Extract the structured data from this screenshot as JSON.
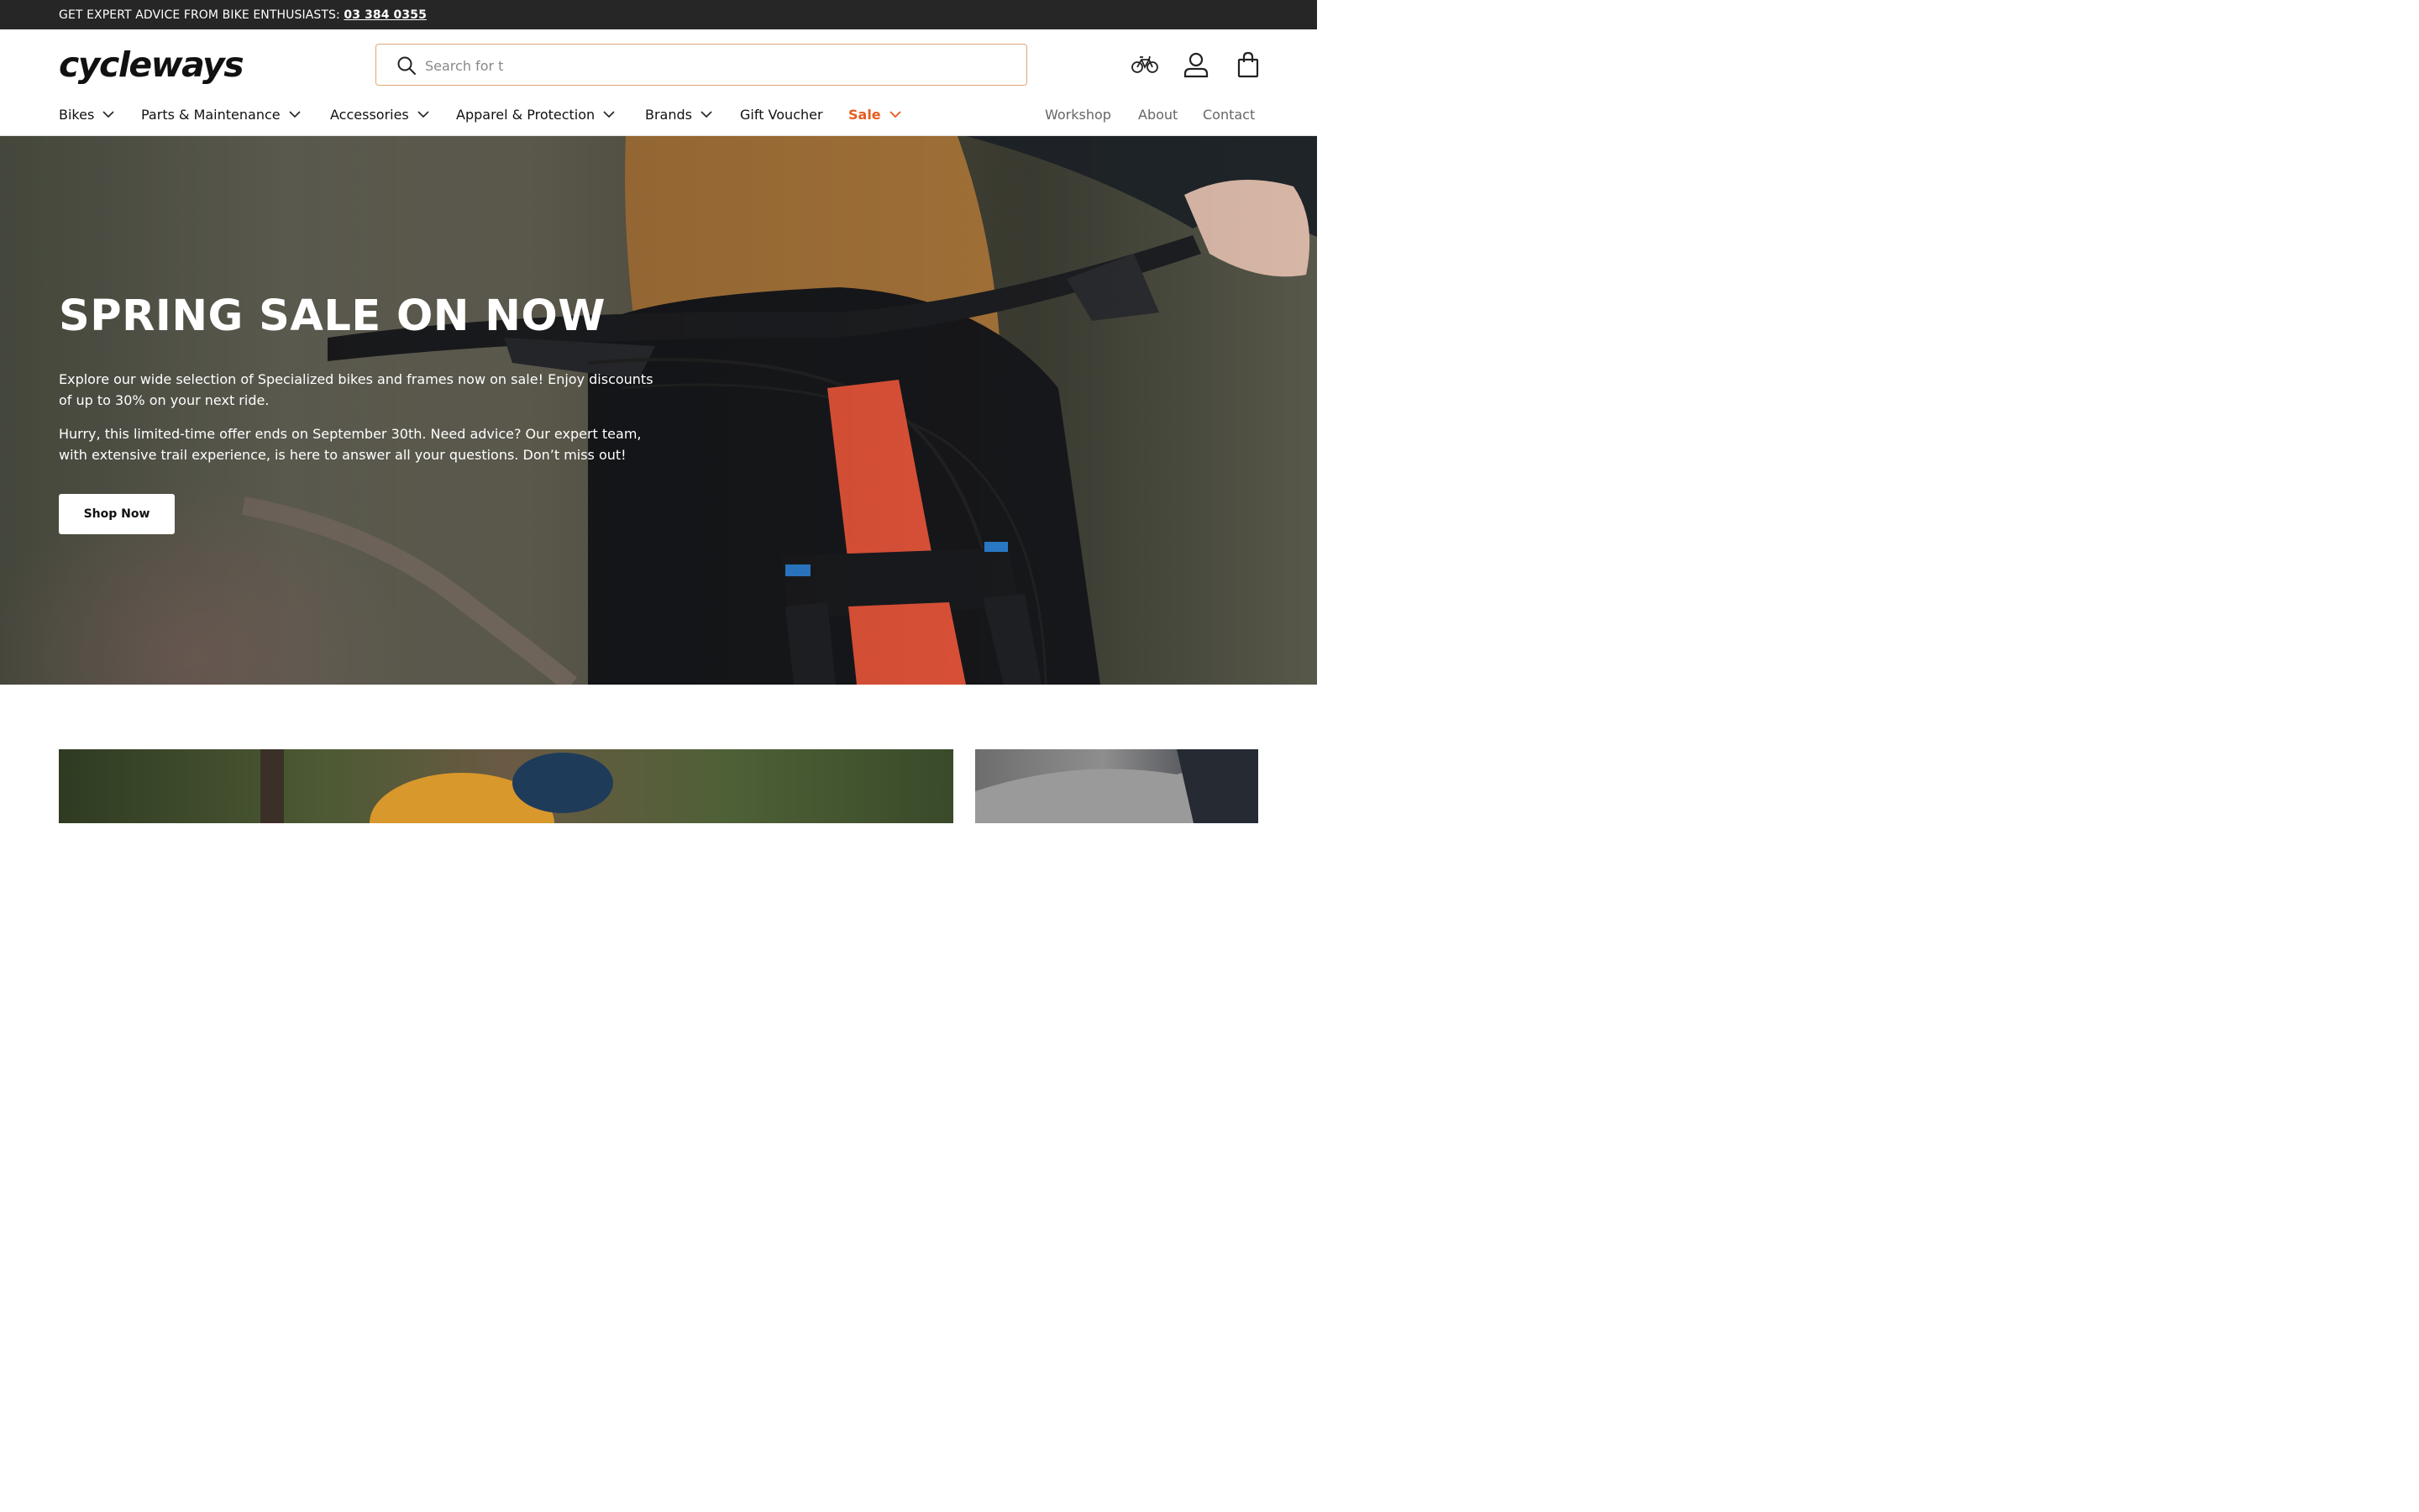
{
  "announcement": {
    "text": "GET EXPERT ADVICE FROM BIKE ENTHUSIASTS:",
    "phone": "03 384 0355"
  },
  "header": {
    "logo": "cycleways",
    "search_placeholder": "Search for t",
    "icons": [
      "bike-icon",
      "account-icon",
      "bag-icon"
    ]
  },
  "nav": {
    "items": [
      {
        "label": "Bikes"
      },
      {
        "label": "Parts & Maintenance"
      },
      {
        "label": "Accessories"
      },
      {
        "label": "Apparel & Protection"
      },
      {
        "label": "Brands"
      },
      {
        "label": "Gift Voucher"
      },
      {
        "label": "Sale"
      }
    ],
    "right_links": [
      {
        "label": "Workshop"
      },
      {
        "label": "About"
      },
      {
        "label": "Contact"
      }
    ]
  },
  "hero": {
    "title": "SPRING SALE ON NOW",
    "paragraph1": "Explore our wide selection of Specialized bikes and frames now on sale! Enjoy discounts of up to 30% on your next ride.",
    "paragraph2": "Hurry, this limited-time offer ends on September 30th. Need advice? Our expert team, with extensive trail experience, is here to answer all your questions. Don’t miss out!",
    "cta": "Shop Now"
  },
  "colors": {
    "accent_sale": "#e65c1e",
    "topbar_bg": "#262626",
    "search_border": "#e0a878"
  }
}
